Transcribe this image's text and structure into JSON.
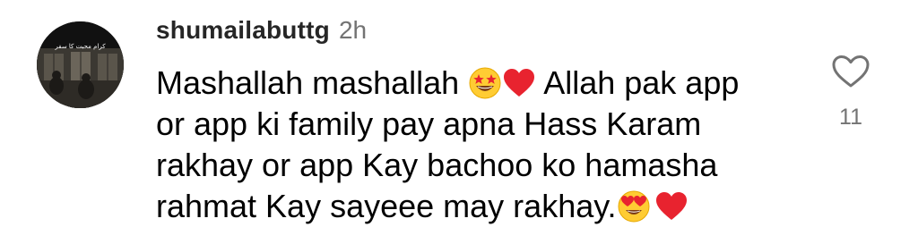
{
  "comment": {
    "username": "shumailabuttg",
    "time": "2h",
    "avatar_caption": "کرام محبت کا سفر",
    "text_segments": {
      "l1a": "Mashallah mashallah ",
      "l1b": " Allah pak app",
      "l2": "or app ki family pay apna Hass Karam",
      "l3": "rakhay or app Kay bachoo ko hamasha",
      "l4": "rahmat Kay sayeee may rakhay."
    },
    "emojis": [
      "star-struck-emoji",
      "red-heart-emoji",
      "heart-eyes-emoji",
      "red-heart-emoji"
    ],
    "like_count": "11"
  },
  "colors": {
    "username": "#262626",
    "secondary": "#737373",
    "heart_red": "#e8232f",
    "emoji_yellow": "#ffcc33"
  }
}
